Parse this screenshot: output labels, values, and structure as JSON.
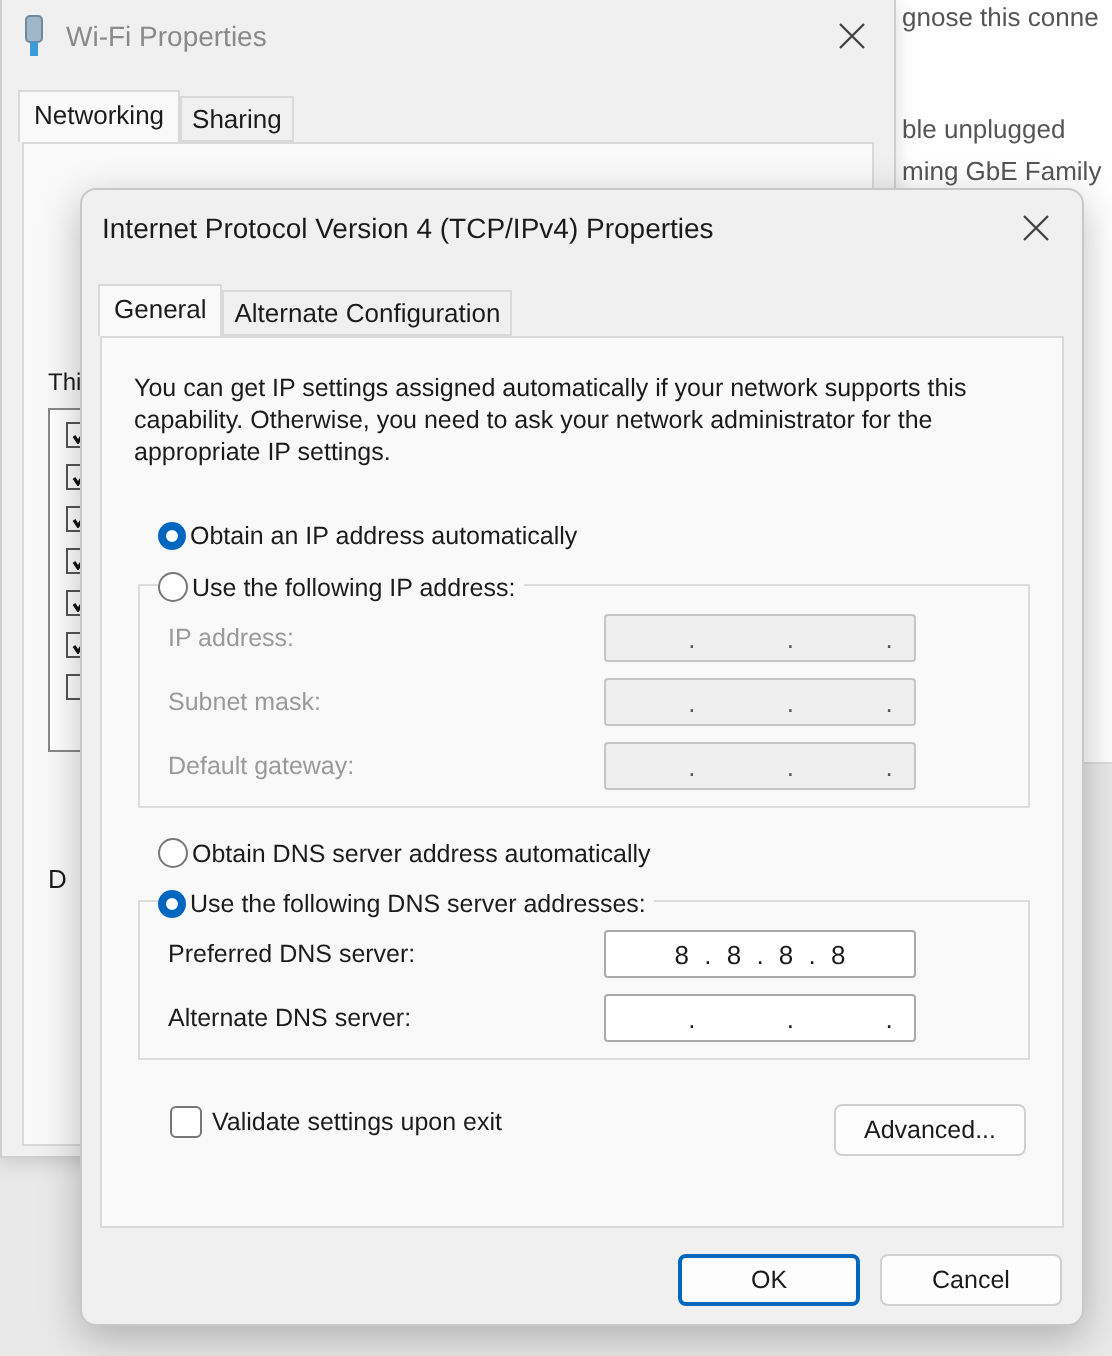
{
  "back_window": {
    "lines": [
      "gnose this conne",
      "ble unplugged",
      "ming GbE Family"
    ]
  },
  "wifi_window": {
    "title": "Wi-Fi Properties",
    "tabs": [
      {
        "label": "Networking",
        "selected": true
      },
      {
        "label": "Sharing",
        "selected": false
      }
    ],
    "list_heading": "Thi",
    "items": [
      {
        "checked": true
      },
      {
        "checked": true
      },
      {
        "checked": true
      },
      {
        "checked": true
      },
      {
        "checked": true
      },
      {
        "checked": true
      },
      {
        "checked": false
      }
    ],
    "group_label": "D"
  },
  "dialog": {
    "title": "Internet Protocol Version 4 (TCP/IPv4) Properties",
    "tabs": [
      {
        "label": "General",
        "selected": true
      },
      {
        "label": "Alternate Configuration",
        "selected": false
      }
    ],
    "description": "You can get IP settings assigned automatically if your network supports this capability. Otherwise, you need to ask your network administrator for the appropriate IP settings.",
    "ip_options": [
      {
        "label": "Obtain an IP address automatically",
        "selected": true
      },
      {
        "label": "Use the following IP address:",
        "selected": false
      }
    ],
    "ip_group": {
      "disabled": true,
      "fields": [
        {
          "label": "IP address:",
          "value": "    .      .      ."
        },
        {
          "label": "Subnet mask:",
          "value": "    .      .      ."
        },
        {
          "label": "Default gateway:",
          "value": "    .      .      ."
        }
      ]
    },
    "dns_options": [
      {
        "label": "Obtain DNS server address automatically",
        "selected": false
      },
      {
        "label": "Use the following DNS server addresses:",
        "selected": true
      }
    ],
    "dns_group": {
      "disabled": false,
      "fields": [
        {
          "label": "Preferred DNS server:",
          "value": "8 . 8 . 8 . 8"
        },
        {
          "label": "Alternate DNS server:",
          "value": "    .      .      ."
        }
      ]
    },
    "validate": {
      "label": "Validate settings upon exit",
      "checked": false
    },
    "advanced_button": "Advanced...",
    "buttons": [
      {
        "label": "OK",
        "default": true
      },
      {
        "label": "Cancel",
        "default": false
      }
    ]
  }
}
